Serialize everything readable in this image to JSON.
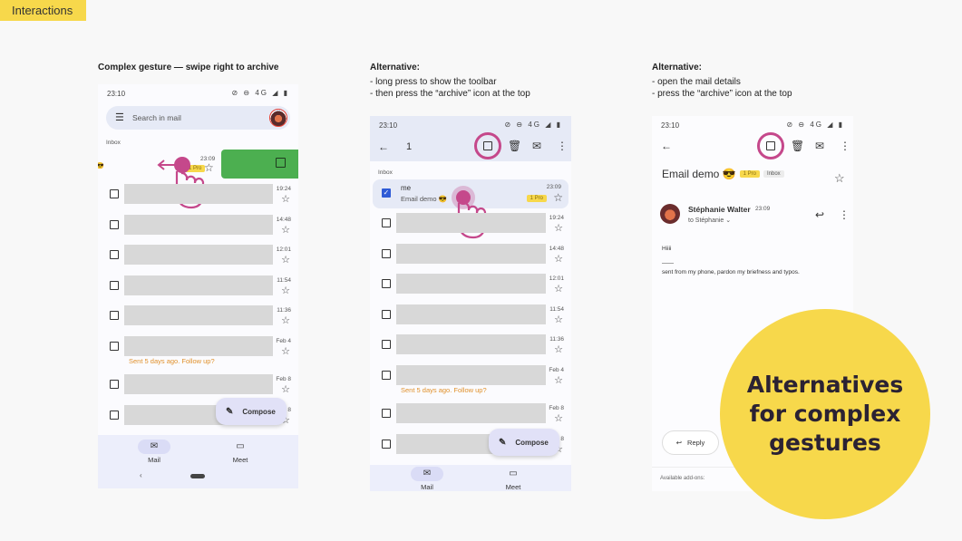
{
  "section_tag": "Interactions",
  "colors": {
    "accent_yellow": "#f7d84b",
    "gesture_magenta": "#c5488b",
    "archive_green": "#4caf50",
    "followup_orange": "#e0912c",
    "nav_bg": "#eceefb"
  },
  "panel1": {
    "caption_title": "Complex gesture — swipe right to archive",
    "status_time": "23:10",
    "status_icons": "⊘ ⊖ 4G ◢ ▮",
    "search_placeholder": "Search in mail",
    "inbox_label": "Inbox",
    "swiped_row": {
      "time": "23:09",
      "badge": "1 Pro"
    },
    "rows": [
      {
        "time": "19:24"
      },
      {
        "time": "14:48"
      },
      {
        "time": "12:01"
      },
      {
        "time": "11:54"
      },
      {
        "time": "11:36"
      },
      {
        "time": "Feb 4",
        "followup": "Sent 5 days ago. Follow up?"
      },
      {
        "time": "Feb 8"
      },
      {
        "time": "Feb 8"
      }
    ],
    "compose_label": "Compose",
    "nav": [
      {
        "label": "Mail",
        "icon": "mail-icon"
      },
      {
        "label": "Meet",
        "icon": "video-icon"
      }
    ]
  },
  "panel2": {
    "caption_title": "Alternative:",
    "caption_lines": [
      "- long press to show the toolbar",
      "- then press the “archive” icon at the top"
    ],
    "status_time": "23:10",
    "status_icons": "⊘ ⊖ 4G ◢ ▮",
    "selected_count": "1",
    "inbox_label": "Inbox",
    "selected_row": {
      "sender": "me",
      "subject": "Email demo 😎",
      "time": "23:09",
      "badge": "1 Pro"
    },
    "rows": [
      {
        "time": "19:24"
      },
      {
        "time": "14:48"
      },
      {
        "time": "12:01"
      },
      {
        "time": "11:54"
      },
      {
        "time": "11:36"
      },
      {
        "time": "Feb 4",
        "followup": "Sent 5 days ago. Follow up?"
      },
      {
        "time": "Feb 8"
      },
      {
        "time": "Feb 8"
      }
    ],
    "compose_label": "Compose",
    "nav": [
      {
        "label": "Mail",
        "icon": "mail-icon"
      },
      {
        "label": "Meet",
        "icon": "video-icon"
      }
    ]
  },
  "panel3": {
    "caption_title": "Alternative:",
    "caption_lines": [
      "- open the mail details",
      "- press the “archive” icon at the top"
    ],
    "status_time": "23:10",
    "status_icons": "⊘ ⊖ 4G ◢ ▮",
    "subject": "Email demo 😎",
    "badge_pro": "1 Pro",
    "badge_inbox": "Inbox",
    "sender_name": "Stéphanie Walter",
    "sent_time": "23:09",
    "recipient": "to Stéphanie",
    "body_greeting": "Hiiii",
    "body_separator": "——",
    "body_signature": "sent from my phone, pardon my briefness and typos.",
    "reply_label": "Reply",
    "addons_label": "Available add-ons:"
  },
  "callout": "Alternatives\nfor complex\ngestures"
}
